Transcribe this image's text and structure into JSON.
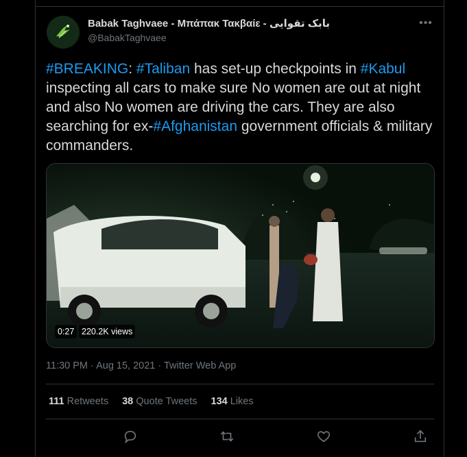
{
  "author": {
    "name": "Babak Taghvaee - Μπάπακ Τακβαίε - بابک تقوایی",
    "handle": "@BabakTaghvaee"
  },
  "tweet": {
    "segments": [
      {
        "text": "#BREAKING",
        "type": "hashtag"
      },
      {
        "text": ": ",
        "type": "text"
      },
      {
        "text": "#Taliban",
        "type": "hashtag"
      },
      {
        "text": " has set-up checkpoints in ",
        "type": "text"
      },
      {
        "text": "#Kabul",
        "type": "hashtag"
      },
      {
        "text": " inspecting all cars to make sure No women are out at night and also No women are driving the cars. They are also searching for ex-",
        "type": "text"
      },
      {
        "text": "#Afghanistan",
        "type": "hashtag"
      },
      {
        "text": " government officials & military commanders.",
        "type": "text"
      }
    ]
  },
  "media": {
    "duration": "0:27",
    "views": "220.2K views"
  },
  "meta": {
    "time": "11:30 PM",
    "separator": " · ",
    "date": "Aug 15, 2021",
    "source": "Twitter Web App"
  },
  "stats": {
    "retweets": {
      "count": "111",
      "label": "Retweets"
    },
    "quotes": {
      "count": "38",
      "label": "Quote Tweets"
    },
    "likes": {
      "count": "134",
      "label": "Likes"
    }
  },
  "icons": {
    "more": "more-icon",
    "reply": "reply-icon",
    "retweet": "retweet-icon",
    "like": "like-icon",
    "share": "share-icon"
  },
  "colors": {
    "background": "#000000",
    "text": "#d9d9d9",
    "secondary": "#6e767d",
    "hashtag": "#1d9bf0",
    "border": "#2f3336"
  }
}
